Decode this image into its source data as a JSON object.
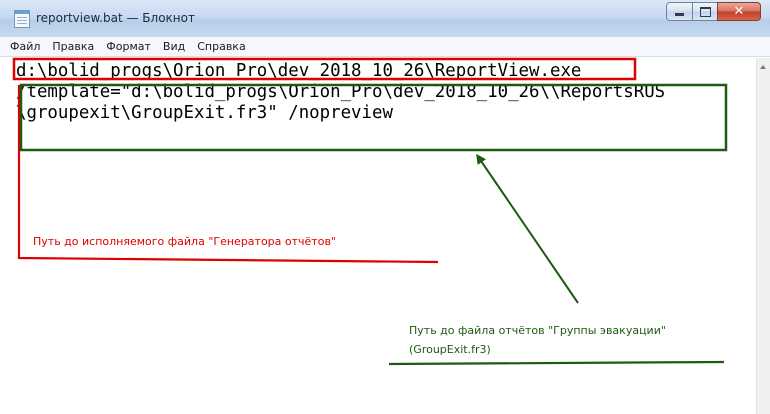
{
  "window": {
    "title": "reportview.bat — Блокнот",
    "minimize_icon": "minimize-icon",
    "maximize_icon": "maximize-icon",
    "close_glyph": "✕"
  },
  "menu": {
    "items": [
      "Файл",
      "Правка",
      "Формат",
      "Вид",
      "Справка"
    ]
  },
  "editor": {
    "lines": [
      "d:\\bolid_progs\\Orion_Pro\\dev_2018_10_26\\ReportView.exe",
      "/template=\"d:\\bolid_progs\\Orion_Pro\\dev_2018_10_26\\\\ReportsRUS",
      "\\groupexit\\GroupExit.fr3\" /nopreview"
    ]
  },
  "annotations": {
    "red_note": "Путь до исполняемого файла \"Генератора отчётов\"",
    "green_note_line1": "Путь до файла отчётов \"Группы эвакуации\"",
    "green_note_line2": "(GroupExit.fr3)",
    "colors": {
      "red": "#e00000",
      "green": "#1e5a12"
    }
  }
}
